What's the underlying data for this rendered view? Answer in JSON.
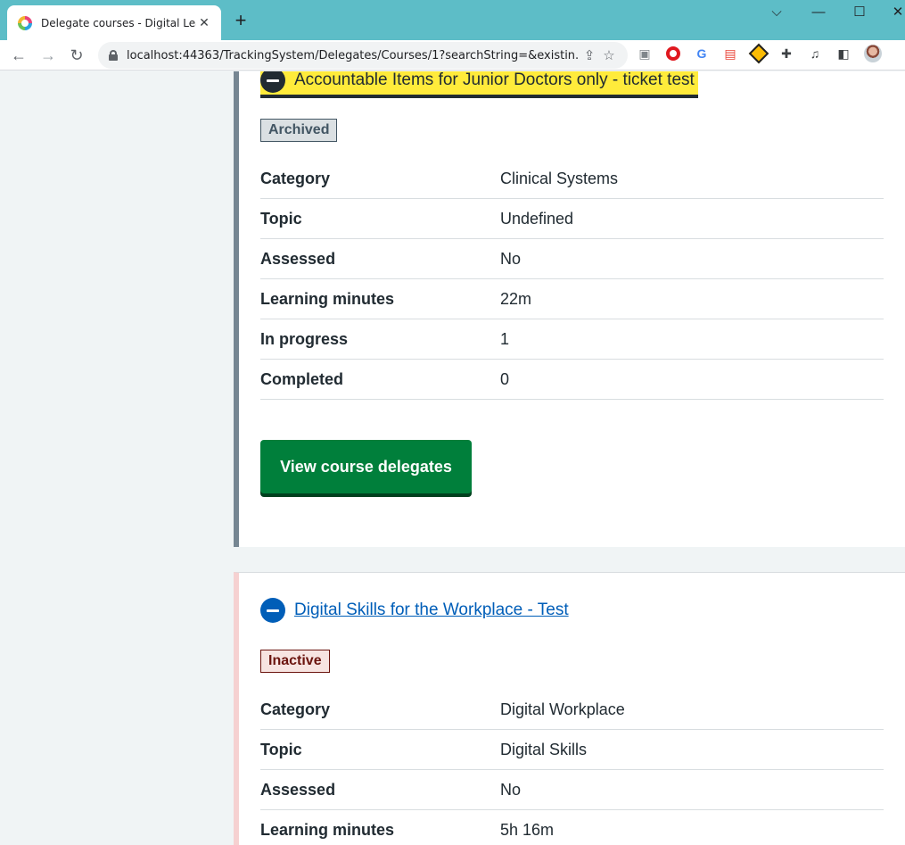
{
  "browser": {
    "tab_title": "Delegate courses - Digital Learning",
    "new_tab_symbol": "+",
    "url": "localhost:44363/TrackingSystem/Delegates/Courses/1?searchString=&existin..."
  },
  "courses": [
    {
      "title": "Accountable Items for Junior Doctors only - ticket test",
      "status": "Archived",
      "rows": [
        {
          "key": "Category",
          "value": "Clinical Systems"
        },
        {
          "key": "Topic",
          "value": "Undefined"
        },
        {
          "key": "Assessed",
          "value": "No"
        },
        {
          "key": "Learning minutes",
          "value": "22m"
        },
        {
          "key": "In progress",
          "value": "1"
        },
        {
          "key": "Completed",
          "value": "0"
        }
      ],
      "action_label": "View course delegates"
    },
    {
      "title": "Digital Skills for the Workplace - Test",
      "status": "Inactive",
      "rows": [
        {
          "key": "Category",
          "value": "Digital Workplace"
        },
        {
          "key": "Topic",
          "value": "Digital Skills"
        },
        {
          "key": "Assessed",
          "value": "No"
        },
        {
          "key": "Learning minutes",
          "value": "5h 16m"
        }
      ]
    }
  ],
  "colors": {
    "tabbar": "#5dbdc7",
    "focus_yellow": "#ffeb3b",
    "nhs_blue": "#005eb8",
    "nhs_green": "#007f3b",
    "archived_border": "#768692",
    "inactive_border": "#f6d1d1"
  }
}
